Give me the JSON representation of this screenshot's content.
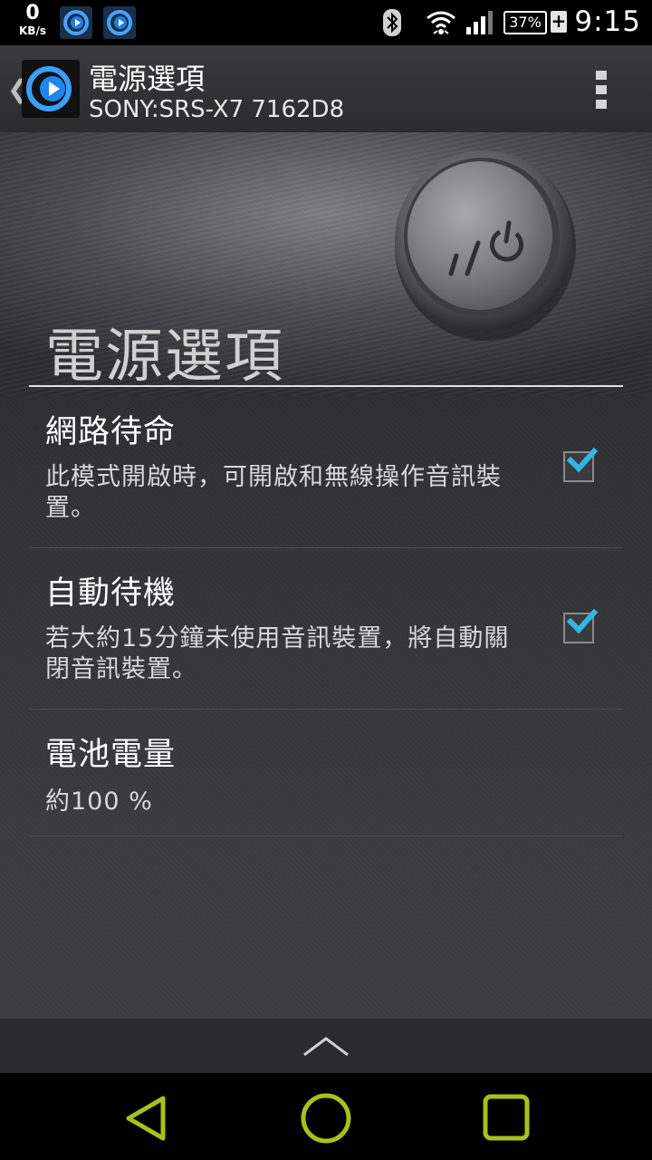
{
  "status_bar": {
    "net_speed_value": "0",
    "net_speed_unit": "KB/s",
    "battery_percent": "37%",
    "battery_charging_symbol": "+",
    "time": "9:15",
    "icons": [
      "app-notification-icon",
      "app-notification-icon",
      "bluetooth-icon",
      "wifi-icon",
      "signal-icon",
      "battery-icon"
    ]
  },
  "action_bar": {
    "back_symbol": "❮",
    "title": "電源選項",
    "subtitle": "SONY:SRS-X7 7162D8",
    "menu_icon": "overflow-menu-icon"
  },
  "banner": {
    "header": "電源選項",
    "image_icon": "power-button-image"
  },
  "preferences": [
    {
      "title": "網路待命",
      "summary": "此模式開啟時，可開啟和無線操作音訊裝置。",
      "checked": true
    },
    {
      "title": "自動待機",
      "summary": "若大約15分鐘未使用音訊裝置，將自動關閉音訊裝置。",
      "checked": true
    },
    {
      "title": "電池電量",
      "summary": "約100 %",
      "checked": false
    }
  ],
  "colors": {
    "accent_check": "#33b5e5",
    "nav_icons": "#a4c21c",
    "background": "#2b2c2e"
  },
  "navigation": {
    "collapse_icon": "chevron-up-icon",
    "buttons": [
      "back-icon",
      "home-icon",
      "recents-icon"
    ]
  }
}
